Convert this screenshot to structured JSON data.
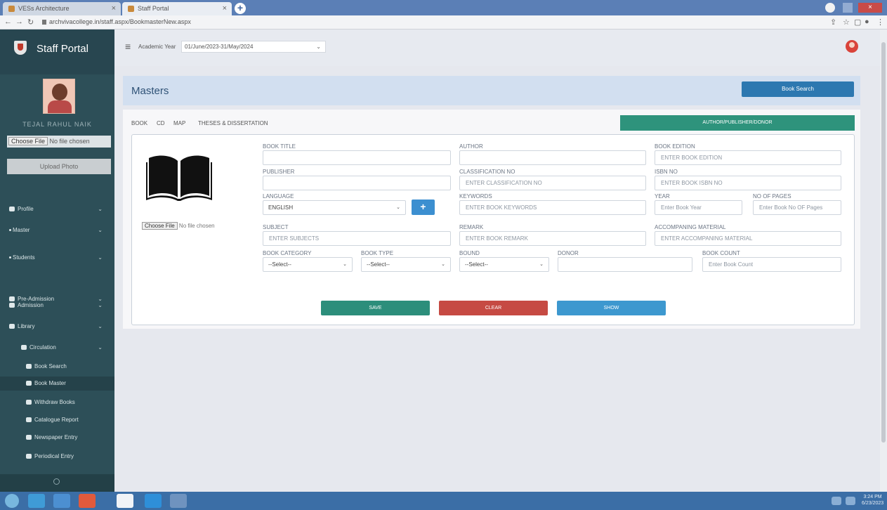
{
  "browser": {
    "tabs": [
      {
        "label": "VESs Architecture"
      },
      {
        "label": "Staff Portal"
      }
    ],
    "new_tab_label": "+",
    "url": "archvivacollege.in/staff.aspx/BookmasterNew.aspx"
  },
  "sidebar": {
    "title": "Staff Portal",
    "user_name": "TEJAL RAHUL NAIK",
    "file_button": "Choose File",
    "file_status": "No file chosen",
    "upload_label": "Upload Photo",
    "menu": [
      {
        "label": "Profile"
      },
      {
        "label": "Master"
      },
      {
        "label": "Students"
      },
      {
        "label": "Pre-Admission"
      },
      {
        "label": "Admission"
      },
      {
        "label": "Library"
      },
      {
        "label": "Circulation"
      },
      {
        "label": "Book Search"
      },
      {
        "label": "Book Master"
      },
      {
        "label": "Withdraw Books"
      },
      {
        "label": "Catalogue Report"
      },
      {
        "label": "Newspaper Entry"
      },
      {
        "label": "Periodical Entry"
      }
    ]
  },
  "topbar": {
    "academic_year_label": "Academic Year",
    "academic_year_value": "01/June/2023-31/May/2024"
  },
  "main": {
    "title": "Masters",
    "book_search_label": "Book Search",
    "tabs": [
      {
        "label": "BOOK"
      },
      {
        "label": "CD"
      },
      {
        "label": "MAP"
      },
      {
        "label": "THESES & DISSERTATION"
      }
    ],
    "authors_button": "AUTHOR/PUBLISHER/DONOR",
    "image_file_button": "Choose File",
    "image_file_status": "No file chosen",
    "fields": {
      "book_title": {
        "label": "BOOK TITLE",
        "placeholder": ""
      },
      "author": {
        "label": "AUTHOR",
        "placeholder": ""
      },
      "book_edition": {
        "label": "BOOK EDITION",
        "placeholder": "ENTER BOOK EDITION"
      },
      "publisher": {
        "label": "PUBLISHER",
        "placeholder": ""
      },
      "classification_no": {
        "label": "CLASSIFICATION NO",
        "placeholder": "ENTER CLASSIFICATION NO"
      },
      "isbn_no": {
        "label": "ISBN NO",
        "placeholder": "ENTER BOOK ISBN NO"
      },
      "language": {
        "label": "LANGUAGE",
        "value": "ENGLISH"
      },
      "keywords": {
        "label": "KEYWORDS",
        "placeholder": "ENTER BOOK KEYWORDS"
      },
      "year": {
        "label": "YEAR",
        "placeholder": "Enter Book Year"
      },
      "no_of_pages": {
        "label": "NO OF PAGES",
        "placeholder": "Enter Book No OF Pages"
      },
      "subject": {
        "label": "SUBJECT",
        "placeholder": "ENTER SUBJECTS"
      },
      "remark": {
        "label": "REMARK",
        "placeholder": "ENTER BOOK REMARK"
      },
      "accompanying_material": {
        "label": "ACCOMPANING MATERIAL",
        "placeholder": "ENTER ACCOMPANING MATERIAL"
      },
      "book_category": {
        "label": "BOOK CATEGORY",
        "value": "--Select--"
      },
      "book_type": {
        "label": "BOOK TYPE",
        "value": "--Select--"
      },
      "bound": {
        "label": "BOUND",
        "value": "--Select--"
      },
      "donor": {
        "label": "DONOR",
        "placeholder": ""
      },
      "book_count": {
        "label": "BOOK COUNT",
        "placeholder": "Enter Book Count"
      }
    },
    "add_language_label": "+",
    "save_label": "SAVE",
    "clear_label": "CLEAR",
    "show_label": "SHOW"
  },
  "taskbar": {
    "time": "3:24 PM",
    "date": "6/23/2023"
  },
  "colors": {
    "sidebar": "#2d4f58",
    "primary": "#2d78b0",
    "success": "#2c8e7b",
    "danger": "#c64a43",
    "info": "#3d98cf"
  }
}
